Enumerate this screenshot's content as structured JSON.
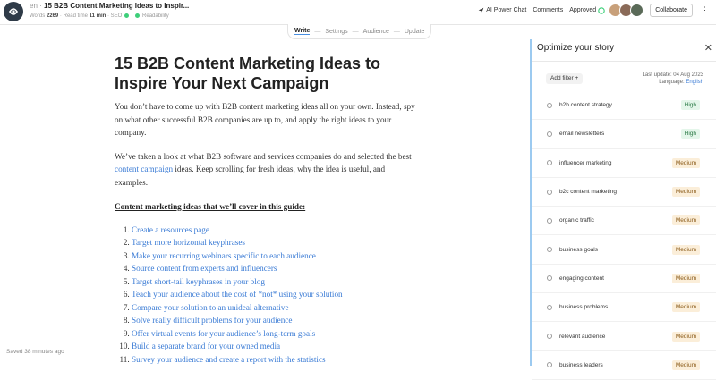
{
  "header": {
    "lang": "en",
    "title": "15 B2B Content Marketing Ideas to Inspir...",
    "words_label": "Words",
    "words_count": "2269",
    "read_time_label": "Read time",
    "read_time_value": "11 min",
    "seo_label": "SEO",
    "readability_label": "Readability",
    "ai_chat": "AI Power Chat",
    "comments": "Comments",
    "approved": "Approved",
    "collaborate": "Collaborate",
    "avatar_colors": [
      "#c8a07a",
      "#8a6a58",
      "#5a6a58"
    ]
  },
  "steps": [
    {
      "label": "Write",
      "active": true
    },
    {
      "label": "Settings",
      "active": false
    },
    {
      "label": "Audience",
      "active": false
    },
    {
      "label": "Update",
      "active": false
    }
  ],
  "article": {
    "title": "15 B2B Content Marketing Ideas to Inspire Your Next Campaign",
    "para1": "You don’t have to come up with B2B content marketing ideas all on your own. Instead, spy on what other successful B2B companies are up to, and apply the right ideas to your company.",
    "para2_before": "We’ve taken a look at what B2B software and services companies do and selected the best",
    "para2_link": "content campaign",
    "para2_after": "ideas. Keep scrolling for fresh ideas, why the idea is useful, and examples.",
    "toc_heading": "Content marketing ideas that we’ll cover in this guide:",
    "toc": [
      "Create a resources page",
      "Target more horizontal keyphrases",
      "Make your recurring webinars specific to each audience",
      "Source content from experts and influencers",
      "Target short-tail keyphrases in your blog",
      "Teach your audience about the cost of *not* using your solution",
      "Compare your solution to an unideal alternative",
      "Solve really difficult problems for your audience",
      "Offer virtual events for your audience’s long-term goals",
      "Build a separate brand for your owned media",
      "Survey your audience and create a report with the statistics"
    ]
  },
  "status": {
    "saved": "Saved 38 minutes ago"
  },
  "panel": {
    "title": "Optimize your story",
    "add_filter": "Add filter +",
    "last_update": "Last update: 04 Aug 2023",
    "language_label": "Language:",
    "language_value": "English",
    "keywords": [
      {
        "label": "b2b content strategy",
        "level": "High"
      },
      {
        "label": "email newsletters",
        "level": "High"
      },
      {
        "label": "influencer marketing",
        "level": "Medium"
      },
      {
        "label": "b2c content marketing",
        "level": "Medium"
      },
      {
        "label": "organic traffic",
        "level": "Medium"
      },
      {
        "label": "business goals",
        "level": "Medium"
      },
      {
        "label": "engaging content",
        "level": "Medium"
      },
      {
        "label": "business problems",
        "level": "Medium"
      },
      {
        "label": "relevant audience",
        "level": "Medium"
      },
      {
        "label": "business leaders",
        "level": "Medium"
      }
    ]
  }
}
